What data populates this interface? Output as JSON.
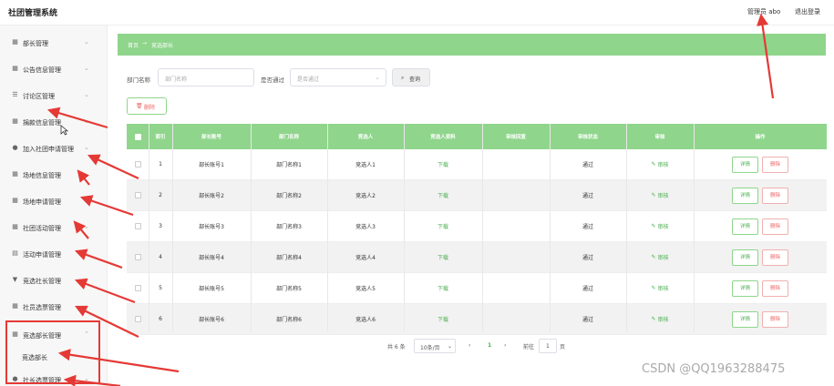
{
  "app": {
    "title": "社团管理系统",
    "user_label": "管理员 abo",
    "logout_label": "退出登录"
  },
  "sidebar": {
    "items": [
      {
        "label": "部长管理",
        "icon": "grid-icon"
      },
      {
        "label": "公告信息管理",
        "icon": "grid-icon"
      },
      {
        "label": "讨论区管理",
        "icon": "list-icon"
      },
      {
        "label": "捐款信息管理",
        "icon": "grid-icon"
      },
      {
        "label": "加入社团申请管理",
        "icon": "pin-icon"
      },
      {
        "label": "场地信息管理",
        "icon": "grid-icon"
      },
      {
        "label": "场地申请管理",
        "icon": "grid-icon"
      },
      {
        "label": "社团活动管理",
        "icon": "grid-icon"
      },
      {
        "label": "活动申请管理",
        "icon": "doc-icon"
      },
      {
        "label": "竞选社长管理",
        "icon": "shield-icon"
      },
      {
        "label": "社员选票管理",
        "icon": "grid-icon"
      },
      {
        "label": "竞选部长管理",
        "icon": "grid-icon"
      },
      {
        "label": "社长选票管理",
        "icon": "pin-icon"
      }
    ],
    "subitem": "竞选部长"
  },
  "breadcrumb": {
    "home": "首页",
    "separator": "→",
    "current": "竞选部长"
  },
  "filters": {
    "dept_label": "部门名称",
    "dept_placeholder": "部门名称",
    "pass_label": "是否通过",
    "pass_placeholder": "是否通过",
    "search_label": "查询",
    "search_icon": "search-icon"
  },
  "toolbar": {
    "delete_label": "删除",
    "delete_icon": "trash-icon"
  },
  "table": {
    "headers": [
      "索引",
      "部长账号",
      "部门名称",
      "竞选人",
      "竞选人资料",
      "审核回复",
      "审核状态",
      "审核",
      "操作"
    ],
    "rows": [
      {
        "index": "1",
        "account": "部长账号1",
        "dept": "部门名称1",
        "candidate": "竞选人1",
        "file": "下载",
        "reply": "",
        "status": "通过",
        "audit": "审核"
      },
      {
        "index": "2",
        "account": "部长账号2",
        "dept": "部门名称2",
        "candidate": "竞选人2",
        "file": "下载",
        "reply": "",
        "status": "通过",
        "audit": "审核"
      },
      {
        "index": "3",
        "account": "部长账号3",
        "dept": "部门名称3",
        "candidate": "竞选人3",
        "file": "下载",
        "reply": "",
        "status": "通过",
        "audit": "审核"
      },
      {
        "index": "4",
        "account": "部长账号4",
        "dept": "部门名称4",
        "candidate": "竞选人4",
        "file": "下载",
        "reply": "",
        "status": "通过",
        "audit": "审核"
      },
      {
        "index": "5",
        "account": "部长账号5",
        "dept": "部门名称5",
        "candidate": "竞选人5",
        "file": "下载",
        "reply": "",
        "status": "通过",
        "audit": "审核"
      },
      {
        "index": "6",
        "account": "部长账号6",
        "dept": "部门名称6",
        "candidate": "竞选人6",
        "file": "下载",
        "reply": "",
        "status": "通过",
        "audit": "审核"
      }
    ],
    "detail_label": "详情",
    "delete_label": "删除"
  },
  "pager": {
    "total": "共 6 条",
    "page_size": "10条/页",
    "prev": "‹",
    "current": "1",
    "next": "›",
    "goto_label": "前往",
    "goto_value": "1",
    "page_unit": "页"
  },
  "watermark": "CSDN @QQ1963288475",
  "colors": {
    "accent": "#8fd58c",
    "annotation": "#e53935"
  }
}
